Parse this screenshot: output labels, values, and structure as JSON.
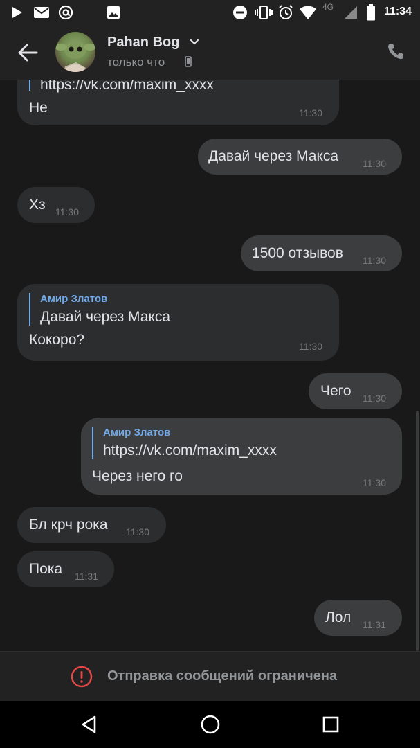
{
  "status_bar": {
    "time": "11:34",
    "network": "4G",
    "icons": [
      "play-icon",
      "gmail-icon",
      "at-icon",
      "image-icon",
      "dnd-icon",
      "vibrate-icon",
      "alarm-icon",
      "wifi-icon",
      "signal-icon",
      "battery-icon"
    ]
  },
  "header": {
    "name": "Pahan Bog",
    "last_seen": "только что",
    "icons": [
      "back-arrow-icon",
      "chevron-down-icon",
      "mobile-icon",
      "phone-icon"
    ]
  },
  "messages": [
    {
      "dir": "in",
      "link": "https://vk.com/maxim_xxxx",
      "text": "Не",
      "time": "11:30"
    },
    {
      "dir": "out",
      "text": "Давай через Макса",
      "time": "11:30"
    },
    {
      "dir": "in",
      "text": "Хз",
      "time": "11:30"
    },
    {
      "dir": "out",
      "text": "1500 отзывов",
      "time": "11:30"
    },
    {
      "dir": "in",
      "reply_author": "Амир Златов",
      "reply_text": "Давай через Макса",
      "text": "Кокоро?",
      "time": "11:30"
    },
    {
      "dir": "out",
      "text": "Чего",
      "time": "11:30"
    },
    {
      "dir": "out",
      "reply_author": "Амир Златов",
      "reply_text": "https://vk.com/maxim_xxxx",
      "text": "Через него го",
      "time": "11:30"
    },
    {
      "dir": "in",
      "text": "Бл крч рока",
      "time": "11:30"
    },
    {
      "dir": "in",
      "text": "Пока",
      "time": "11:31"
    },
    {
      "dir": "out",
      "text": "Лол",
      "time": "11:31"
    }
  ],
  "bottom_bar": {
    "text": "Отправка сообщений ограничена",
    "icon": "warning-icon",
    "color": "#e64646"
  },
  "nav": {
    "icons": [
      "nav-back-icon",
      "nav-home-icon",
      "nav-recents-icon"
    ]
  },
  "colors": {
    "background": "#19191a",
    "incoming_bubble": "#2c2d2e",
    "outgoing_bubble": "#3c3d3f",
    "accent": "#71aaeb"
  }
}
